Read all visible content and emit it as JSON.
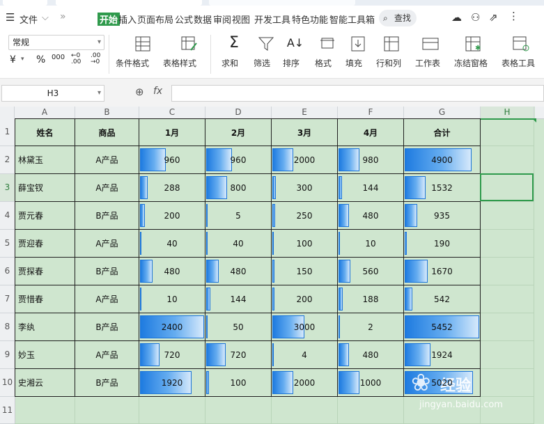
{
  "menu": {
    "file": "文件",
    "tabs": [
      "开始",
      "插入",
      "页面布局",
      "公式",
      "数据",
      "审阅",
      "视图",
      "开发工具",
      "特色功能",
      "智能工具箱"
    ],
    "active_tab": "开始",
    "search": "查找"
  },
  "ribbon": {
    "number_format": "常规",
    "currency_symbol": "¥",
    "percent_symbol": "%",
    "thousands_symbol": "000",
    "increase_decimal": "←0 .00",
    "decrease_decimal": ".00 →0",
    "buttons": [
      "条件格式",
      "表格样式",
      "求和",
      "筛选",
      "排序",
      "格式",
      "填充",
      "行和列",
      "工作表",
      "冻结窗格",
      "表格工具"
    ]
  },
  "formula_bar": {
    "cell_ref": "H3",
    "fx_label": "fx",
    "formula": ""
  },
  "columns": [
    "A",
    "B",
    "C",
    "D",
    "E",
    "F",
    "G",
    "H"
  ],
  "rows": [
    "1",
    "2",
    "3",
    "4",
    "5",
    "6",
    "7",
    "8",
    "9",
    "10",
    "11"
  ],
  "table": {
    "headers": [
      "姓名",
      "商品",
      "1月",
      "2月",
      "3月",
      "4月",
      "合计"
    ],
    "data": [
      [
        "林黛玉",
        "A产品",
        "960",
        "960",
        "2000",
        "980",
        "4900"
      ],
      [
        "薛宝钗",
        "A产品",
        "288",
        "800",
        "300",
        "144",
        "1532"
      ],
      [
        "贾元春",
        "B产品",
        "200",
        "5",
        "250",
        "480",
        "935"
      ],
      [
        "贾迎春",
        "A产品",
        "40",
        "40",
        "100",
        "10",
        "190"
      ],
      [
        "贾探春",
        "B产品",
        "480",
        "480",
        "150",
        "560",
        "1670"
      ],
      [
        "贾惜春",
        "A产品",
        "10",
        "144",
        "200",
        "188",
        "542"
      ],
      [
        "李纨",
        "B产品",
        "2400",
        "50",
        "3000",
        "2",
        "5452"
      ],
      [
        "妙玉",
        "A产品",
        "720",
        "720",
        "4",
        "480",
        "1924"
      ],
      [
        "史湘云",
        "B产品",
        "1920",
        "100",
        "2000",
        "1000",
        "5020"
      ]
    ],
    "bar_fractions": [
      [
        0.4,
        0.4,
        0.33,
        0.33,
        0.9
      ],
      [
        0.12,
        0.33,
        0.05,
        0.05,
        0.28
      ],
      [
        0.08,
        0.0,
        0.04,
        0.16,
        0.17
      ],
      [
        0.02,
        0.02,
        0.02,
        0.0,
        0.03
      ],
      [
        0.2,
        0.2,
        0.03,
        0.19,
        0.31
      ],
      [
        0.0,
        0.06,
        0.03,
        0.06,
        0.1
      ],
      [
        1.0,
        0.02,
        0.5,
        0.0,
        1.0
      ],
      [
        0.3,
        0.3,
        0.0,
        0.16,
        0.35
      ],
      [
        0.8,
        0.04,
        0.33,
        0.33,
        0.92
      ]
    ]
  },
  "watermark": {
    "brand": "经验",
    "url": "jingyan.baidu.com"
  }
}
